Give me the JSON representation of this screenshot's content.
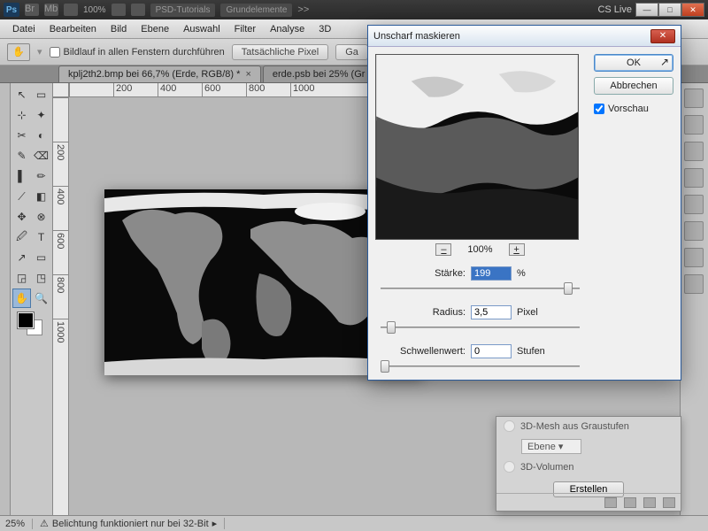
{
  "app": {
    "name": "Ps",
    "zoom_header": "100%",
    "cs_live": "CS Live"
  },
  "chrome_tabs": [
    "PSD-Tutorials",
    "Grundelemente"
  ],
  "chrome_more": ">>",
  "chrome_badges": [
    "Br",
    "Mb"
  ],
  "window_buttons": {
    "min": "—",
    "max": "□",
    "close": "✕"
  },
  "menu": [
    "Datei",
    "Bearbeiten",
    "Bild",
    "Ebene",
    "Auswahl",
    "Filter",
    "Analyse",
    "3D"
  ],
  "options": {
    "scroll_all_label": "Bildlauf in allen Fenstern durchführen",
    "btn_actual": "Tatsächliche Pixel",
    "btn_fit": "Ga"
  },
  "doc_tabs": [
    {
      "label": "kplj2th2.bmp bei 66,7% (Erde, RGB/8) *",
      "active": true
    },
    {
      "label": "erde.psb bei 25% (Gr",
      "active": false
    }
  ],
  "ruler_h": [
    "",
    "200",
    "400",
    "600",
    "800",
    "1000"
  ],
  "ruler_v": [
    "",
    "200",
    "400",
    "600",
    "800",
    "1000"
  ],
  "status": {
    "zoom": "25%",
    "msg": "Belichtung funktioniert nur bei 32-Bit"
  },
  "dialog": {
    "title": "Unscharf maskieren",
    "ok": "OK",
    "cancel": "Abbrechen",
    "preview_label": "Vorschau",
    "zoom_minus": "–",
    "zoom_plus": "+",
    "zoom_value": "100%",
    "params": {
      "strength": {
        "label": "Stärke:",
        "value": "199",
        "unit": "%",
        "pos": 92
      },
      "radius": {
        "label": "Radius:",
        "value": "3,5",
        "unit": "Pixel",
        "pos": 3
      },
      "threshold": {
        "label": "Schwellenwert:",
        "value": "0",
        "unit": "Stufen",
        "pos": 0
      }
    }
  },
  "float_panel": {
    "line1": "3D-Mesh aus Graustufen",
    "select": "Ebene",
    "radio": "3D-Volumen",
    "create": "Erstellen"
  },
  "tools": [
    "↖",
    "▭",
    "⊹",
    "✦",
    "✂",
    "◐",
    "✎",
    "⌫",
    "▌",
    "✏",
    "⟋",
    "◧",
    "✥",
    "⊗",
    "🖉",
    "T",
    "↗",
    "▭",
    "✋",
    "🔍"
  ]
}
